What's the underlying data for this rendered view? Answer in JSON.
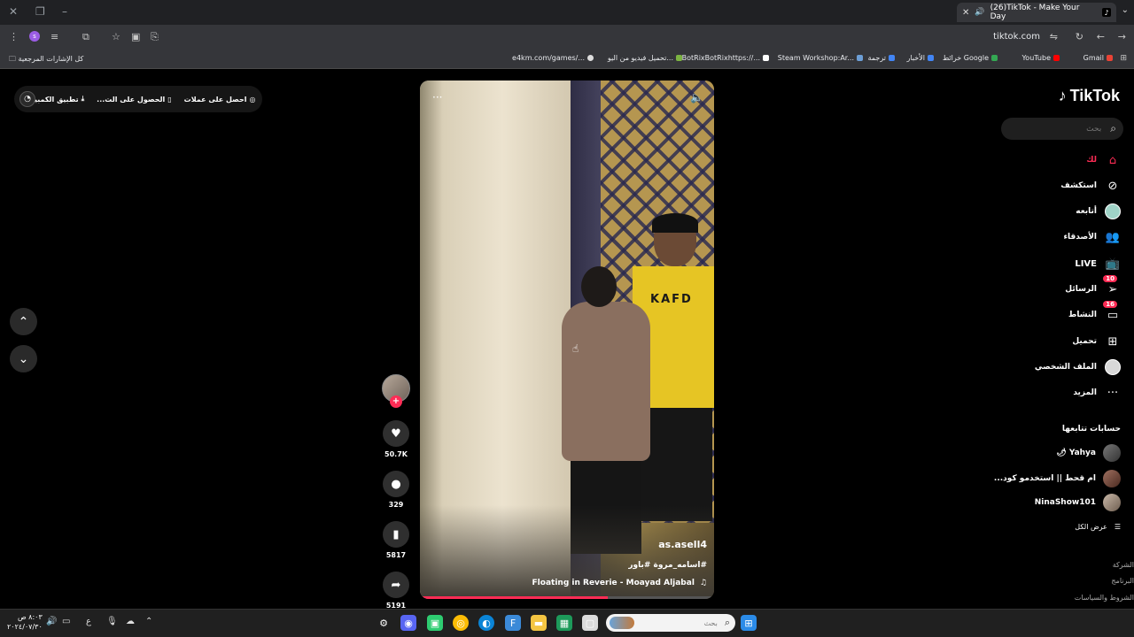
{
  "browser": {
    "tab_title": "(26)TikTok - Make Your Day",
    "url": "tiktok.com",
    "profile_initial": "s",
    "bookmarks": [
      {
        "label": "Gmail",
        "color": "#ea4335"
      },
      {
        "label": "YouTube",
        "color": "#ff0000"
      },
      {
        "label": "خرائط Google",
        "color": "#34a853"
      },
      {
        "label": "الأخبار",
        "color": "#4285f4"
      },
      {
        "label": "ترجمة",
        "color": "#4285f4"
      },
      {
        "label": "Steam Workshop:Ar...",
        "color": "#1b2838"
      },
      {
        "label": "BotRixBotRixhttps://...",
        "color": "#ffffff"
      },
      {
        "label": "تحميل فيديو من اليو...",
        "color": "#7cb342"
      },
      {
        "label": "e4km.com/games/...",
        "color": "#dddddd"
      }
    ],
    "all_bookmarks": "كل الإشارات المرجعية"
  },
  "top_pill": {
    "get_coins": "احصل على عملات",
    "get_app": "الحصول على الت...",
    "desktop_app": "تطبيق الكمبيوتر"
  },
  "video": {
    "author": "as.asell4",
    "hashtags": "#اسامه_مروة #باور",
    "music": "Floating in Reverie - Moayad Aljabal",
    "progress_fraction": 0.64,
    "shirt_text": "KAFD"
  },
  "actions": {
    "likes": "50.7K",
    "comments": "329",
    "saves": "5817",
    "shares": "5191"
  },
  "sidebar": {
    "logo": "TikTok",
    "search_placeholder": "بحث",
    "nav": {
      "home": "لك",
      "explore": "استكشف",
      "following": "أتابعه",
      "friends": "الأصدقاء",
      "live": "LIVE",
      "messages": "الرسائل",
      "messages_badge": "10",
      "activity": "النشاط",
      "activity_badge": "16",
      "upload": "تحميل",
      "profile": "الملف الشخصي",
      "more": "المزيد"
    },
    "following_title": "حسابات تتابعها",
    "following": [
      {
        "name": "Yahya 🌶"
      },
      {
        "name": "ام قحط || استخدمو كود..."
      },
      {
        "name": "NinaShow101"
      }
    ],
    "see_all": "عرض الكل",
    "footer": [
      "الشركة",
      "البرنامج",
      "الشروط والسياسات"
    ]
  },
  "taskbar": {
    "search_placeholder": "بحث",
    "time": "٨:٠٣ ص",
    "date": "٢٠٢٤/٠٧/٣٠",
    "lang": "ع"
  }
}
